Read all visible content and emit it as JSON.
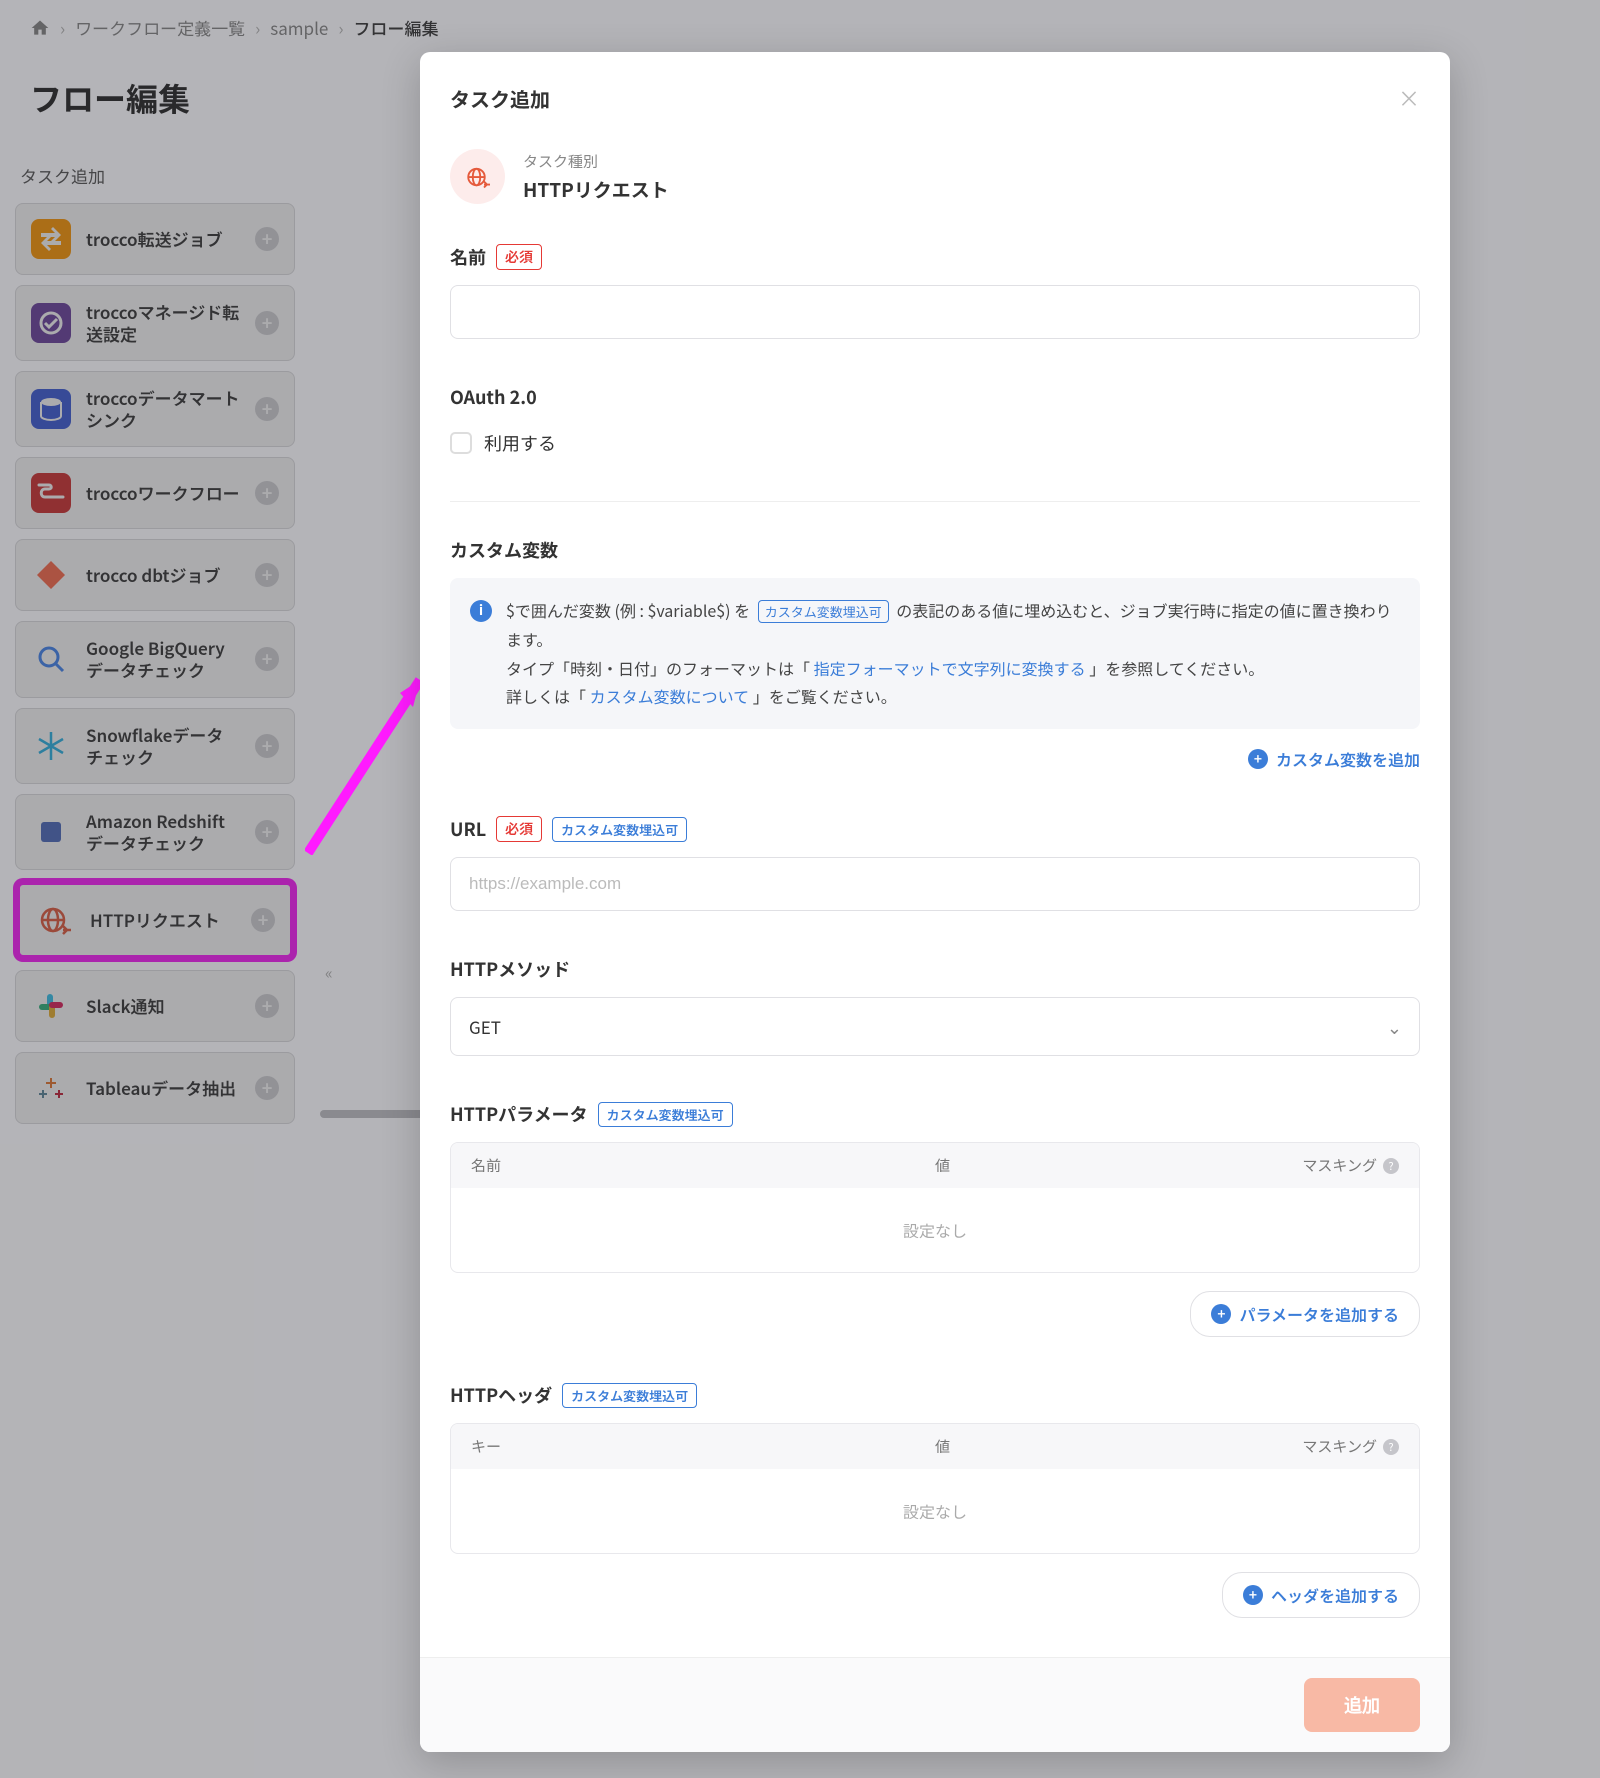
{
  "breadcrumb": {
    "items": [
      "ワークフロー定義一覧",
      "sample",
      "フロー編集"
    ]
  },
  "page_title": "フロー編集",
  "sidebar": {
    "header": "タスク追加",
    "items": [
      {
        "label": "trocco転送ジョブ"
      },
      {
        "label": "troccoマネージド転送設定"
      },
      {
        "label": "troccoデータマートシンク"
      },
      {
        "label": "troccoワークフロー"
      },
      {
        "label": "trocco dbtジョブ"
      },
      {
        "label": "Google BigQueryデータチェック"
      },
      {
        "label": "Snowflakeデータチェック"
      },
      {
        "label": "Amazon Redshiftデータチェック"
      },
      {
        "label": "HTTPリクエスト"
      },
      {
        "label": "Slack通知"
      },
      {
        "label": "Tableauデータ抽出"
      }
    ]
  },
  "modal": {
    "title": "タスク追加",
    "task_type_label": "タスク種別",
    "task_type_value": "HTTPリクエスト",
    "name_label": "名前",
    "required_badge": "必須",
    "var_badge": "カスタム変数埋込可",
    "oauth_label": "OAuth 2.0",
    "oauth_checkbox": "利用する",
    "custom_var_label": "カスタム変数",
    "info_text1_a": "$で囲んだ変数 (例 : $variable$) を ",
    "info_text1_b": " の表記のある値に埋め込むと、ジョブ実行時に指定の値に置き換わります。",
    "info_text2_a": "タイプ「時刻・日付」のフォーマットは「",
    "info_link1": "指定フォーマットで文字列に変換する",
    "info_text2_b": "」を参照してください。",
    "info_text3_a": "詳しくは「",
    "info_link2": "カスタム変数について",
    "info_text3_b": "」をご覧ください。",
    "add_var_link": "カスタム変数を追加",
    "url_label": "URL",
    "url_placeholder": "https://example.com",
    "method_label": "HTTPメソッド",
    "method_value": "GET",
    "params_label": "HTTPパラメータ",
    "headers_label": "HTTPヘッダ",
    "col_name": "名前",
    "col_key": "キー",
    "col_value": "値",
    "col_mask": "マスキング",
    "empty_text": "設定なし",
    "add_param": "パラメータを追加する",
    "add_header": "ヘッダを追加する",
    "submit": "追加"
  }
}
